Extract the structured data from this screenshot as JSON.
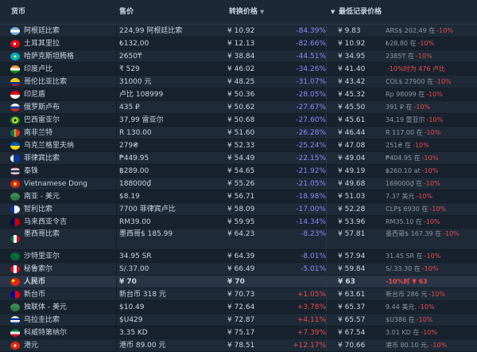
{
  "header": {
    "currency": "货币",
    "price": "售价",
    "converted": "转换价格",
    "lowest": "最低记录价格"
  },
  "rows": [
    {
      "flag": "ar",
      "name": "阿根廷比索",
      "price": "224,99 阿根廷比索",
      "conv": "¥ 10.92",
      "diff": "-84.39%",
      "dir": "neg",
      "low": "¥ 9.83",
      "note": "ARS$ 202,49 在",
      "note2": "-10%",
      "tall": false,
      "hl": false
    },
    {
      "flag": "tr",
      "name": "土耳其里拉",
      "price": "₺132,00",
      "conv": "¥ 12.13",
      "diff": "-82.66%",
      "dir": "neg",
      "low": "¥ 10.92",
      "note": "₺28,80 在",
      "note2": "-10%",
      "tall": false,
      "hl": false
    },
    {
      "flag": "kz",
      "name": "哈萨克斯坦腾格",
      "price": "2650₸",
      "conv": "¥ 38.84",
      "diff": "-44.51%",
      "dir": "neg",
      "low": "¥ 34.95",
      "note": "2385₸ 在",
      "note2": "-10%",
      "tall": false,
      "hl": false
    },
    {
      "flag": "in",
      "name": "印度卢比",
      "price": "₹ 529",
      "conv": "¥ 46.02",
      "diff": "-34.26%",
      "dir": "neg",
      "low": "¥ 41.40",
      "note": "",
      "note2": "-10%时为 476 卢比",
      "tall": false,
      "hl": false
    },
    {
      "flag": "co",
      "name": "哥伦比亚比索",
      "price": "31000 元",
      "conv": "¥ 48.25",
      "diff": "-31.07%",
      "dir": "neg",
      "low": "¥ 43.42",
      "note": "COL$ 27900 在",
      "note2": "-10%",
      "tall": false,
      "hl": false
    },
    {
      "flag": "id",
      "name": "印尼盾",
      "price": "卢比 108999",
      "conv": "¥ 50.36",
      "diff": "-28.05%",
      "dir": "neg",
      "low": "¥ 45.32",
      "note": "Rp 98099 在",
      "note2": "-10%",
      "tall": false,
      "hl": false
    },
    {
      "flag": "ru",
      "name": "俄罗斯卢布",
      "price": "435 ₽",
      "conv": "¥ 50.62",
      "diff": "-27.67%",
      "dir": "neg",
      "low": "¥ 45.50",
      "note": "391 ₽ 在",
      "note2": "-10%",
      "tall": false,
      "hl": false
    },
    {
      "flag": "br",
      "name": "巴西雷亚尔",
      "price": "37,99 雷亚尔",
      "conv": "¥ 50.68",
      "diff": "-27.60%",
      "dir": "neg",
      "low": "¥ 45.61",
      "note": "34,19 雷亚尔",
      "note2": "-10%",
      "tall": false,
      "hl": false
    },
    {
      "flag": "za",
      "name": "南非兰特",
      "price": "R 130.00",
      "conv": "¥ 51.60",
      "diff": "-26.28%",
      "dir": "neg",
      "low": "¥ 46.44",
      "note": "R 117.00 在",
      "note2": "-10%",
      "tall": false,
      "hl": false
    },
    {
      "flag": "ua",
      "name": "乌克兰格里夫纳",
      "price": "279₴",
      "conv": "¥ 52.33",
      "diff": "-25.24%",
      "dir": "neg",
      "low": "¥ 47.08",
      "note": "251₴ 在",
      "note2": "-10%",
      "tall": false,
      "hl": false
    },
    {
      "flag": "ph",
      "name": "菲律宾比索",
      "price": "₱449.95",
      "conv": "¥ 54.49",
      "diff": "-22.15%",
      "dir": "neg",
      "low": "¥ 49.04",
      "note": "₱404.95 在",
      "note2": "-10%",
      "tall": false,
      "hl": false
    },
    {
      "flag": "th",
      "name": "泰铢",
      "price": "฿289.00",
      "conv": "¥ 54.65",
      "diff": "-21.92%",
      "dir": "neg",
      "low": "¥ 49.19",
      "note": "฿260.10 at",
      "note2": "-10%",
      "tall": false,
      "hl": false
    },
    {
      "flag": "vn",
      "name": "Vietnamese Dong",
      "price": "188000₫",
      "conv": "¥ 55.26",
      "diff": "-21.05%",
      "dir": "neg",
      "low": "¥ 49.68",
      "note": "169000₫ 在",
      "note2": "-10%",
      "tall": false,
      "hl": false
    },
    {
      "flag": "cis",
      "name": "南亚 - 美元",
      "price": "$8.19",
      "conv": "¥ 56.71",
      "diff": "-18.98%",
      "dir": "neg",
      "low": "¥ 51.03",
      "note": "7.37 美元",
      "note2": "-10%",
      "tall": false,
      "hl": false
    },
    {
      "flag": "cl",
      "name": "智利比索",
      "price": "7700 菲律宾卢比",
      "conv": "¥ 58.09",
      "diff": "-17.00%",
      "dir": "neg",
      "low": "¥ 52.28",
      "note": "CLP$ 6930 在",
      "note2": "-10%",
      "tall": false,
      "hl": false
    },
    {
      "flag": "my",
      "name": "马来西亚令吉",
      "price": "RM39.00",
      "conv": "¥ 59.95",
      "diff": "-14.34%",
      "dir": "neg",
      "low": "¥ 53.96",
      "note": "RM35.10 在",
      "note2": "-10%",
      "tall": false,
      "hl": false
    },
    {
      "flag": "mx",
      "name": "墨西哥比索",
      "price": "墨西哥$ 185.99",
      "conv": "¥ 64.23",
      "diff": "-8.23%",
      "dir": "neg",
      "low": "¥ 57.81",
      "note": "墨西哥$ 167.39 在",
      "note2": "-10%",
      "tall": true,
      "hl": false
    },
    {
      "flag": "sa",
      "name": "沙特里亚尔",
      "price": "34.95 SR",
      "conv": "¥ 64.39",
      "diff": "-8.01%",
      "dir": "neg",
      "low": "¥ 57.94",
      "note": "31.45 SR 在",
      "note2": "-10%",
      "tall": false,
      "hl": false
    },
    {
      "flag": "pe",
      "name": "秘鲁索尔",
      "price": "S/.37.00",
      "conv": "¥ 66.49",
      "diff": "-5.01%",
      "dir": "neg",
      "low": "¥ 59.84",
      "note": "S/.33.30 在",
      "note2": "-10%",
      "tall": false,
      "hl": false
    },
    {
      "flag": "cn",
      "name": "人民币",
      "price": "¥ 70",
      "conv": "¥ 70",
      "diff": "",
      "dir": "zero",
      "low": "¥ 63",
      "note": "",
      "note2": "-10%时 ¥ 63",
      "tall": false,
      "hl": true
    },
    {
      "flag": "tw",
      "name": "新台币",
      "price": "新台币 318 元",
      "conv": "¥ 70.73",
      "diff": "+1.05%",
      "dir": "pos",
      "low": "¥ 63.61",
      "note": "新台币 286 元",
      "note2": "-10%",
      "tall": false,
      "hl": false
    },
    {
      "flag": "cis",
      "name": "独联体 - 美元",
      "price": "$10.49",
      "conv": "¥ 72.64",
      "diff": "+3.78%",
      "dir": "pos",
      "low": "¥ 65.37",
      "note": "9.44 美元.",
      "note2": "-10%",
      "tall": false,
      "hl": false
    },
    {
      "flag": "uy",
      "name": "乌拉圭比索",
      "price": "$U429",
      "conv": "¥ 72.87",
      "diff": "+4.11%",
      "dir": "pos",
      "low": "¥ 65.57",
      "note": "$U386 在",
      "note2": "-10%",
      "tall": false,
      "hl": false
    },
    {
      "flag": "kw",
      "name": "科威特第纳尔",
      "price": "3.35 KD",
      "conv": "¥ 75.17",
      "diff": "+7.39%",
      "dir": "pos",
      "low": "¥ 67.54",
      "note": "3.01 KD 在",
      "note2": "-10%",
      "tall": false,
      "hl": false
    },
    {
      "flag": "hk",
      "name": "港元",
      "price": "港币 89.00 元",
      "conv": "¥ 78.51",
      "diff": "+12.17%",
      "dir": "pos",
      "low": "¥ 70.66",
      "note": "港币 80.10 元.",
      "note2": "-10%",
      "tall": false,
      "hl": false
    }
  ]
}
